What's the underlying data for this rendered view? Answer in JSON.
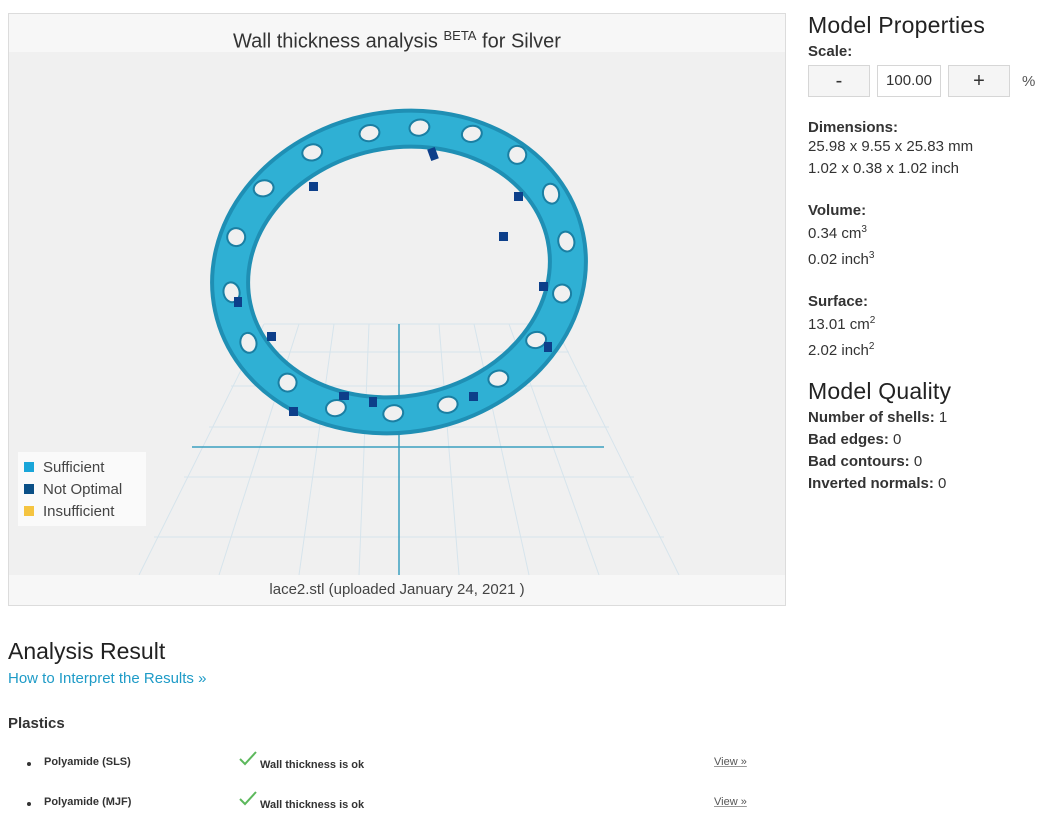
{
  "viewer": {
    "title_main": "Wall thickness analysis",
    "title_sup": "BETA",
    "title_suffix": "for Silver",
    "file_info": "lace2.stl (uploaded January 24, 2021 )"
  },
  "legend": [
    {
      "label": "Sufficient",
      "color": "#1aa6d9"
    },
    {
      "label": "Not Optimal",
      "color": "#0a4f86"
    },
    {
      "label": "Insufficient",
      "color": "#f5c440"
    }
  ],
  "model_properties": {
    "title": "Model Properties",
    "scale_label": "Scale:",
    "scale_minus": "-",
    "scale_value": "100.00",
    "scale_plus": "+",
    "scale_unit": "%",
    "dimensions_label": "Dimensions:",
    "dimensions_mm": "25.98 x 9.55 x 25.83 mm",
    "dimensions_inch": "1.02 x 0.38 x 1.02 inch",
    "volume_label": "Volume:",
    "volume_cm": "0.34 cm",
    "volume_inch": "0.02 inch",
    "surface_label": "Surface:",
    "surface_cm": "13.01 cm",
    "surface_inch": "2.02 inch",
    "sup3": "3",
    "sup2": "2"
  },
  "model_quality": {
    "title": "Model Quality",
    "shells_label": "Number of shells:",
    "shells_value": "1",
    "bad_edges_label": "Bad edges:",
    "bad_edges_value": "0",
    "bad_contours_label": "Bad contours:",
    "bad_contours_value": "0",
    "inverted_label": "Inverted normals:",
    "inverted_value": "0"
  },
  "analysis": {
    "title": "Analysis Result",
    "link": "How to Interpret the Results »",
    "section": "Plastics",
    "rows": [
      {
        "name": "Polyamide (SLS)",
        "status": "Wall thickness is ok",
        "view": "View »"
      },
      {
        "name": "Polyamide (MJF)",
        "status": "Wall thickness is ok",
        "view": "View »"
      }
    ]
  },
  "colors": {
    "model": "#2aa5c9",
    "link": "#1e9bc7",
    "check": "#5cb85c"
  }
}
